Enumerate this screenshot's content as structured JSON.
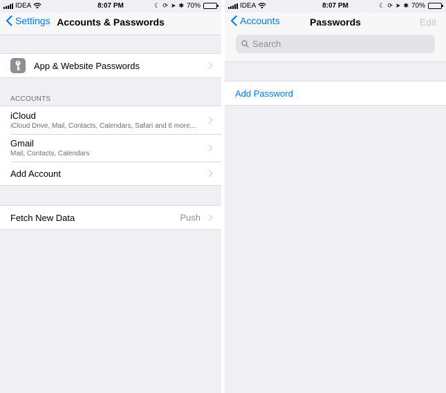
{
  "status_bar": {
    "carrier": "IDEA",
    "time": "8:07 PM",
    "battery": "70%",
    "battery_level": 0.7
  },
  "left_screen": {
    "nav": {
      "back_label": "Settings",
      "title": "Accounts & Passwords"
    },
    "passwords_item": {
      "label": "App & Website Passwords",
      "icon": "key-icon"
    },
    "accounts_section": {
      "header": "ACCOUNTS",
      "items": [
        {
          "title": "iCloud",
          "subtitle": "iCloud Drive, Mail, Contacts, Calendars, Safari and 6 more..."
        },
        {
          "title": "Gmail",
          "subtitle": "Mail, Contacts, Calendars"
        },
        {
          "title": "Add Account"
        }
      ]
    },
    "fetch_item": {
      "label": "Fetch New Data",
      "value": "Push"
    }
  },
  "right_screen": {
    "nav": {
      "back_label": "Accounts",
      "title": "Passwords",
      "edit_label": "Edit"
    },
    "search": {
      "placeholder": "Search"
    },
    "add_password_label": "Add Password"
  },
  "colors": {
    "accent": "#007aff",
    "background": "#efeff4",
    "disabled": "#c7c7cc",
    "secondary_text": "#8e8e93"
  }
}
